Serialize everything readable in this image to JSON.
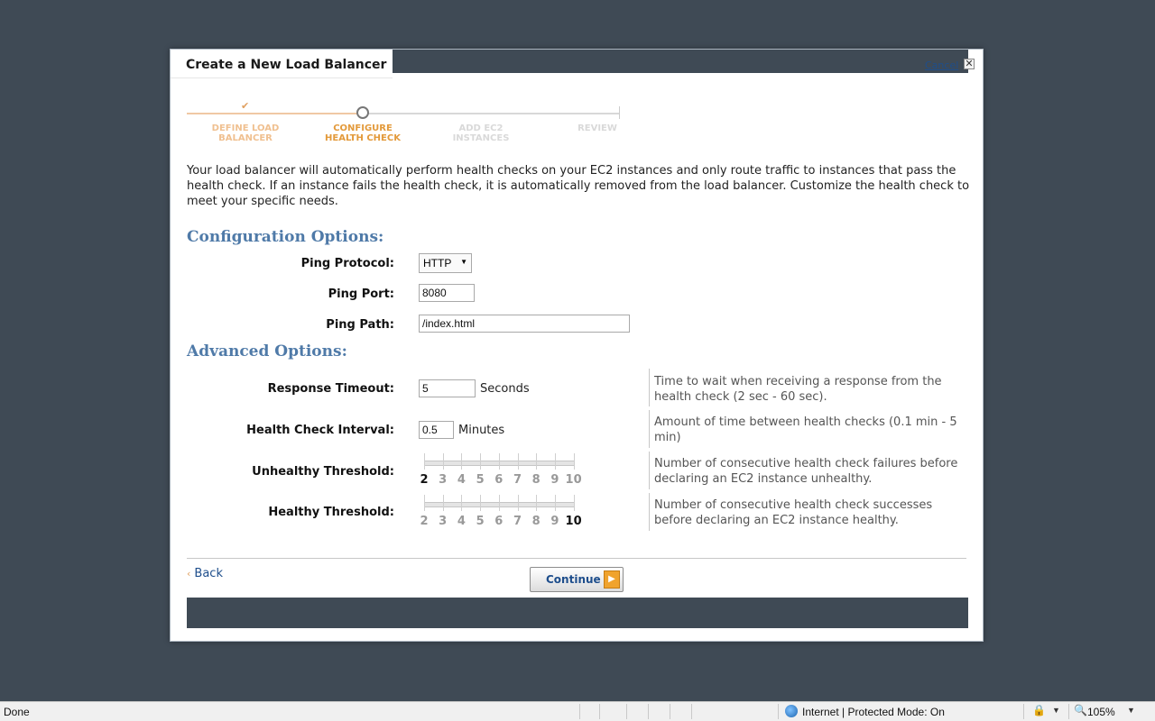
{
  "dialog": {
    "title": "Create a New Load Balancer",
    "cancel_label": "Cancel",
    "close_glyph": "✕"
  },
  "wizard": {
    "done_glyph": "✔",
    "steps": [
      {
        "label_line1": "DEFINE LOAD",
        "label_line2": "BALANCER",
        "state": "done"
      },
      {
        "label_line1": "CONFIGURE",
        "label_line2": "HEALTH CHECK",
        "state": "current"
      },
      {
        "label_line1": "ADD EC2",
        "label_line2": "INSTANCES",
        "state": "pending"
      },
      {
        "label_line1": "REVIEW",
        "label_line2": "",
        "state": "pending"
      }
    ]
  },
  "intro": "Your load balancer will automatically perform health checks on your EC2 instances and only route traffic to instances that pass the health check. If an instance fails the health check, it is automatically removed from the load balancer. Customize the health check to meet your specific needs.",
  "config": {
    "title": "Configuration Options:",
    "ping_protocol_label": "Ping Protocol:",
    "ping_protocol_value": "HTTP",
    "ping_port_label": "Ping Port:",
    "ping_port_value": "8080",
    "ping_path_label": "Ping Path:",
    "ping_path_value": "/index.html"
  },
  "advanced": {
    "title": "Advanced Options:",
    "response_timeout_label": "Response Timeout:",
    "response_timeout_value": "5",
    "response_timeout_unit": "Seconds",
    "response_timeout_help": "Time to wait when receiving a response from the health check (2 sec - 60 sec).",
    "interval_label": "Health Check Interval:",
    "interval_value": "0.5",
    "interval_unit": "Minutes",
    "interval_help": "Amount of time between health checks (0.1 min - 5 min)",
    "unhealthy_label": "Unhealthy Threshold:",
    "unhealthy_value": 2,
    "unhealthy_help": "Number of consecutive health check failures before declaring an EC2 instance unhealthy.",
    "healthy_label": "Healthy Threshold:",
    "healthy_value": 10,
    "healthy_help": "Number of consecutive health check successes before declaring an EC2 instance healthy.",
    "threshold_ticks": [
      "2",
      "3",
      "4",
      "5",
      "6",
      "7",
      "8",
      "9",
      "10"
    ]
  },
  "nav": {
    "back_arrow": "‹",
    "back_label": "Back",
    "continue_label": "Continue",
    "continue_glyph": "▶"
  },
  "statusbar": {
    "status": "Done",
    "zone": "Internet | Protected Mode: On",
    "zoom": "105%",
    "lock_glyph": "🔒",
    "zoom_glyph": "🔍",
    "drop_glyph": "▼"
  },
  "colors": {
    "background": "#3f4a55",
    "accent_orange": "#e39a3b",
    "section_blue": "#4f7aa8",
    "link_blue": "#1e4e8c"
  }
}
